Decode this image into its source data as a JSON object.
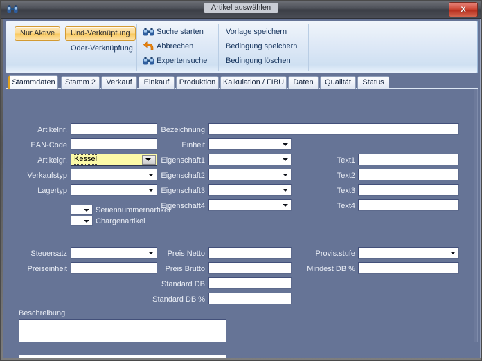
{
  "window": {
    "title": "Artikel auswählen",
    "icon": "binoculars-icon",
    "close_label": "X",
    "colors": {
      "client_bg": "#667496",
      "ribbon_bg": "#dde8f6",
      "accent_orange": "#f8c95f",
      "highlight_field": "#fcfaa8",
      "close_red": "#cf4a38"
    }
  },
  "ribbon": {
    "groups": [
      {
        "name": "filter-group",
        "chips": [
          {
            "label": "Nur Aktive",
            "active": true
          }
        ]
      },
      {
        "name": "link-group",
        "chips": [
          {
            "label": "Und-Verknüpfung",
            "active": true
          },
          {
            "label": "Oder-Verknüpfung",
            "active": false
          }
        ]
      },
      {
        "name": "search-group",
        "commands": [
          {
            "label": "Suche starten",
            "icon": "binoculars-icon"
          },
          {
            "label": "Abbrechen",
            "icon": "undo-arrow-icon"
          },
          {
            "label": "Expertensuche",
            "icon": "binoculars-icon"
          }
        ]
      },
      {
        "name": "template-group",
        "commands": [
          {
            "label": "Vorlage speichern",
            "icon": "none"
          },
          {
            "label": "Bedingung speichern",
            "icon": "none"
          },
          {
            "label": "Bedingung löschen",
            "icon": "none"
          }
        ]
      }
    ]
  },
  "tabs": [
    {
      "label": "Stammdaten",
      "active": true
    },
    {
      "label": "Stamm 2",
      "active": false
    },
    {
      "label": "Verkauf",
      "active": false
    },
    {
      "label": "Einkauf",
      "active": false
    },
    {
      "label": "Produktion",
      "active": false
    },
    {
      "label": "Kalkulation / FIBU",
      "active": false
    },
    {
      "label": "Daten",
      "active": false
    },
    {
      "label": "Qualität",
      "active": false
    },
    {
      "label": "Status",
      "active": false
    }
  ],
  "form": {
    "col_left": [
      {
        "label": "Artikelnr.",
        "type": "text",
        "value": ""
      },
      {
        "label": "EAN-Code",
        "type": "text",
        "value": ""
      },
      {
        "label": "Artikelgr.",
        "type": "combo",
        "value": "Kessel",
        "highlight": true
      },
      {
        "label": "Verkaufstyp",
        "type": "combo",
        "value": ""
      },
      {
        "label": "Lagertyp",
        "type": "combo",
        "value": ""
      }
    ],
    "col_mid": [
      {
        "label": "Bezeichnung",
        "type": "text",
        "value": ""
      },
      {
        "label": "Einheit",
        "type": "combo",
        "value": ""
      },
      {
        "label": "Eigenschaft1",
        "type": "combo",
        "value": ""
      },
      {
        "label": "Eigenschaft2",
        "type": "combo",
        "value": ""
      },
      {
        "label": "Eigenschaft3",
        "type": "combo",
        "value": ""
      },
      {
        "label": "Eigenschaft4",
        "type": "combo",
        "value": ""
      }
    ],
    "col_right": [
      {
        "label": "Text1",
        "type": "text",
        "value": ""
      },
      {
        "label": "Text2",
        "type": "text",
        "value": ""
      },
      {
        "label": "Text3",
        "type": "text",
        "value": ""
      },
      {
        "label": "Text4",
        "type": "text",
        "value": ""
      }
    ],
    "flags": [
      {
        "label": "Seriennummernartikel",
        "type": "combo",
        "value": ""
      },
      {
        "label": "Chargenartikel",
        "type": "combo",
        "value": ""
      }
    ],
    "price_left": [
      {
        "label": "Steuersatz",
        "type": "combo",
        "value": ""
      },
      {
        "label": "Preiseinheit",
        "type": "text",
        "value": ""
      }
    ],
    "price_mid": [
      {
        "label": "Preis Netto",
        "type": "text",
        "value": ""
      },
      {
        "label": "Preis Brutto",
        "type": "text",
        "value": ""
      },
      {
        "label": "Standard DB",
        "type": "text",
        "value": ""
      },
      {
        "label": "Standard DB %",
        "type": "text",
        "value": ""
      }
    ],
    "price_right": [
      {
        "label": "Provis.stufe",
        "type": "combo",
        "value": ""
      },
      {
        "label": "Mindest DB %",
        "type": "text",
        "value": ""
      }
    ],
    "description": {
      "label": "Beschreibung",
      "value": ""
    }
  }
}
